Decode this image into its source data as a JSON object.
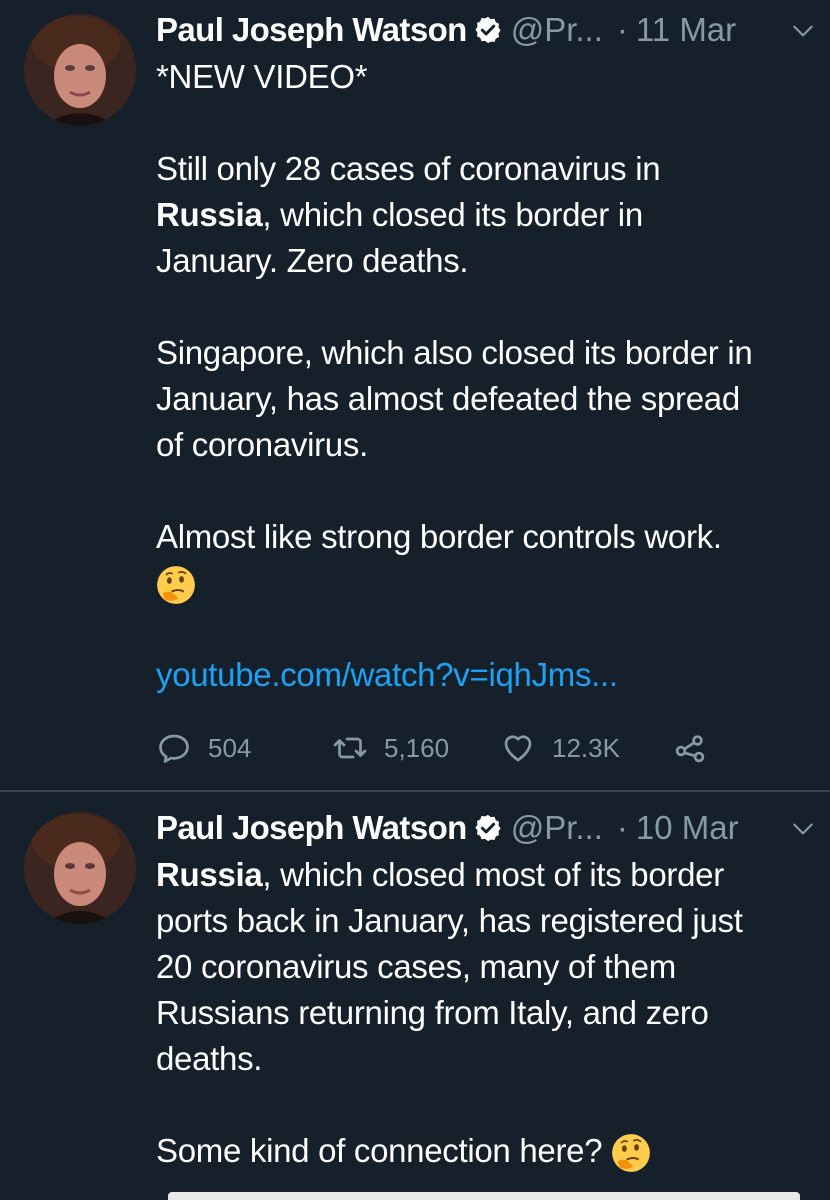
{
  "tweets": [
    {
      "author": "Paul Joseph Watson",
      "handle": "@Pr...",
      "separator": "·",
      "date": "11 Mar",
      "lines": {
        "l1": "*NEW VIDEO*",
        "l2": "Still only 28 cases of coronavirus in",
        "l3_bold": "Russia",
        "l3_rest": ", which closed its border in",
        "l4": "January. Zero deaths.",
        "l5": "Singapore, which also closed its border in",
        "l6": "January, has almost defeated the spread",
        "l7": "of coronavirus.",
        "l8": "Almost like strong border controls work.",
        "link": "youtube.com/watch?v=iqhJms..."
      },
      "emoji_icon": "thinking-face-icon",
      "stats": {
        "replies": "504",
        "retweets": "5,160",
        "likes": "12.3K"
      }
    },
    {
      "author": "Paul Joseph Watson",
      "handle": "@Pr...",
      "separator": "·",
      "date": "10 Mar",
      "lines": {
        "l1_bold": "Russia",
        "l1_rest": ", which closed most of its border",
        "l2": "ports back in January, has registered just",
        "l3": "20 coronavirus cases, many of them",
        "l4": "Russians returning from Italy, and zero",
        "l5": "deaths.",
        "l6": "Some kind of connection here?"
      },
      "emoji_icon": "thinking-face-icon"
    }
  ],
  "colors": {
    "background": "#15202b",
    "link": "#1da1f2",
    "muted": "#8899a6",
    "divider": "#38444d"
  }
}
